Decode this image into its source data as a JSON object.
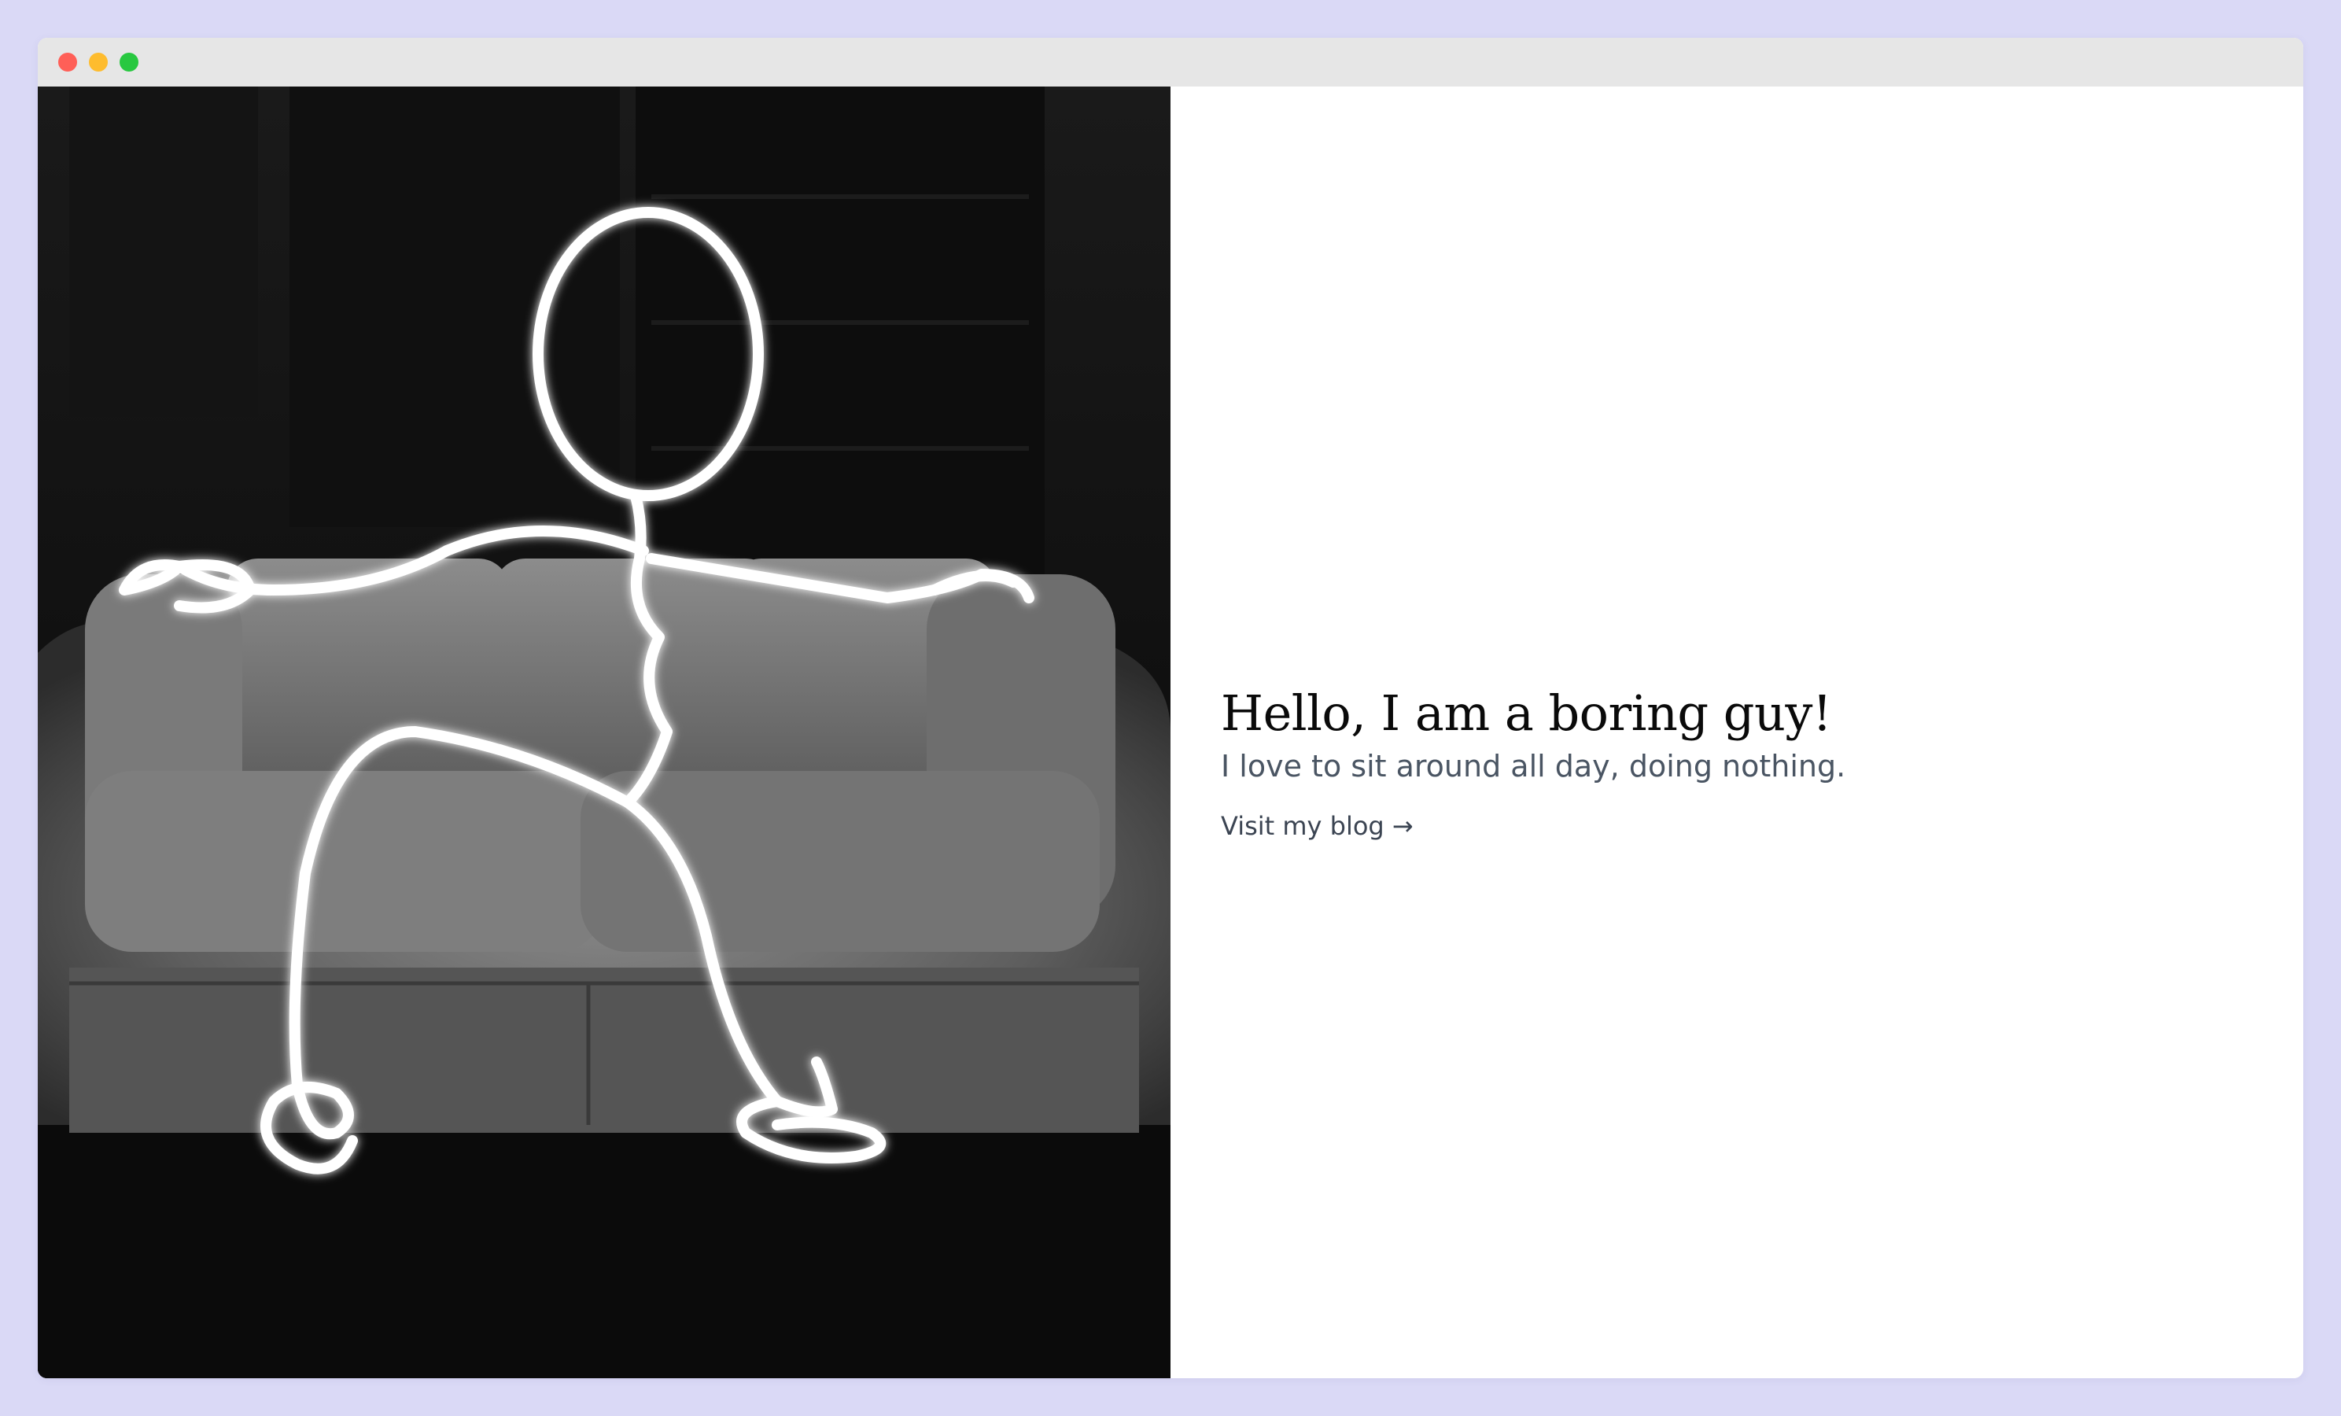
{
  "window": {
    "controls": [
      "close",
      "minimize",
      "zoom"
    ]
  },
  "hero": {
    "image": {
      "description": "Black and white photo of a light-painted stick figure sitting on a couch",
      "subject_icon": "stick-figure-light-painting"
    }
  },
  "intro": {
    "headline": "Hello, I am a boring guy!",
    "subline": "I love to sit around all day, doing nothing.",
    "link_label": "Visit my blog",
    "link_arrow": "→"
  },
  "colors": {
    "page_background": "#dad9f6",
    "titlebar": "#e6e6e6",
    "close": "#ff5f57",
    "minimize": "#febc2e",
    "zoom": "#28c840",
    "headline": "#0a0a0a",
    "body_text": "#4a5563"
  }
}
